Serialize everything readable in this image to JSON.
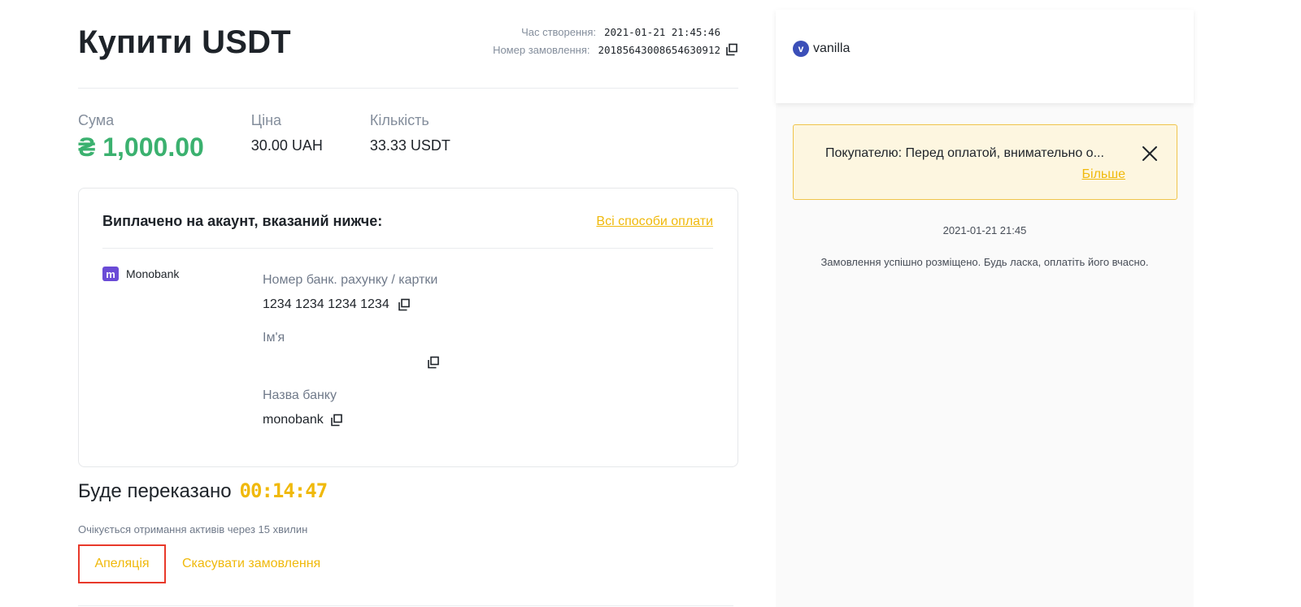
{
  "order": {
    "title": "Купити USDT",
    "created_label": "Час створення:",
    "created_value": "2021-01-21 21:45:46",
    "number_label": "Номер замовлення:",
    "number_value": "20185643008654630912"
  },
  "summary": {
    "amount_label": "Сума",
    "amount_value": "₴ 1,000.00",
    "price_label": "Ціна",
    "price_value": "30.00 UAH",
    "qty_label": "Кількість",
    "qty_value": "33.33 USDT"
  },
  "payment": {
    "title": "Виплачено на акаунт, вказаний нижче:",
    "all_methods_link": "Всі способи оплати",
    "bank_logo_letter": "m",
    "bank_name": "Monobank",
    "fields": [
      {
        "label": "Номер банк. рахунку / картки",
        "value": "1234 1234 1234 1234"
      },
      {
        "label": "Ім'я",
        "value": ""
      },
      {
        "label": "Назва банку",
        "value": "monobank"
      }
    ]
  },
  "transfer": {
    "label": "Буде переказано",
    "timer": "00:14:47",
    "expect_text": "Очікується отримання активів через 15 хвилин",
    "appeal_button": "Апеляція",
    "cancel_link": "Скасувати замовлення"
  },
  "chat": {
    "avatar_letter": "v",
    "username": "vanilla",
    "notice_text": "Покупателю: Перед оплатой, внимательно о...",
    "notice_more": "Більше",
    "message_time": "2021-01-21 21:45",
    "message_text": "Замовлення успішно розміщено. Будь ласка, оплатіть його вчасно."
  },
  "colors": {
    "accent": "#f0b90b",
    "amount_green": "#3bb16f",
    "appeal_border": "#e8392a",
    "notice_bg": "#fdf6e0"
  },
  "icons": {
    "copy": "copy-icon",
    "close": "close-icon"
  }
}
